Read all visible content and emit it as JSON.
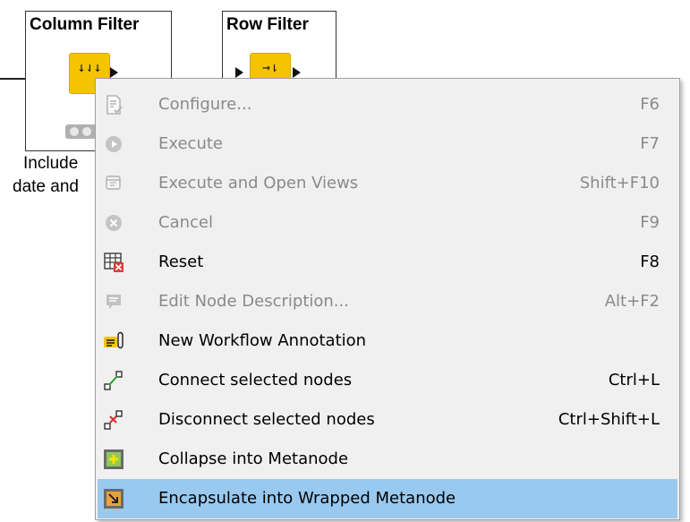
{
  "workflow": {
    "column_filter": {
      "title": "Column Filter",
      "glyph": "↓⇃↓"
    },
    "row_filter": {
      "title": "Row Filter",
      "glyph": "→⇂"
    },
    "annotation_line1": "Include",
    "annotation_line2": "date and"
  },
  "context_menu": {
    "items": [
      {
        "label": "Configure...",
        "shortcut": "F6",
        "enabled": false,
        "icon": "configure-icon"
      },
      {
        "label": "Execute",
        "shortcut": "F7",
        "enabled": false,
        "icon": "execute-icon"
      },
      {
        "label": "Execute and Open Views",
        "shortcut": "Shift+F10",
        "enabled": false,
        "icon": "execute-open-views-icon"
      },
      {
        "label": "Cancel",
        "shortcut": "F9",
        "enabled": false,
        "icon": "cancel-icon"
      },
      {
        "label": "Reset",
        "shortcut": "F8",
        "enabled": true,
        "icon": "reset-icon"
      },
      {
        "label": "Edit Node Description...",
        "shortcut": "Alt+F2",
        "enabled": false,
        "icon": "edit-description-icon"
      },
      {
        "label": "New Workflow Annotation",
        "shortcut": "",
        "enabled": true,
        "icon": "annotation-icon"
      },
      {
        "label": "Connect selected nodes",
        "shortcut": "Ctrl+L",
        "enabled": true,
        "icon": "connect-nodes-icon"
      },
      {
        "label": "Disconnect selected nodes",
        "shortcut": "Ctrl+Shift+L",
        "enabled": true,
        "icon": "disconnect-nodes-icon"
      },
      {
        "label": "Collapse into Metanode",
        "shortcut": "",
        "enabled": true,
        "icon": "collapse-metanode-icon"
      },
      {
        "label": "Encapsulate into Wrapped Metanode",
        "shortcut": "",
        "enabled": true,
        "icon": "wrapped-metanode-icon",
        "highlighted": true
      }
    ]
  },
  "colors": {
    "node_yellow": "#f5c400",
    "menu_background": "#f0f0f0",
    "highlight": "#99c9ef",
    "disabled_text": "#8a8a8a"
  }
}
